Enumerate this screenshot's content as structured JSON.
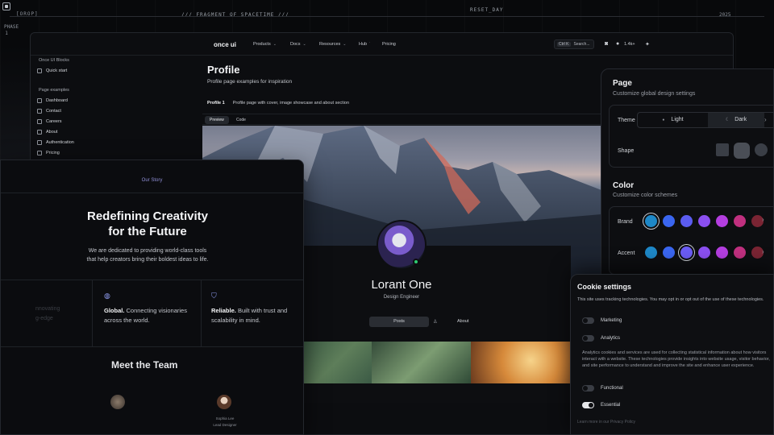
{
  "frame": {
    "bracket_tag": "[OROP]",
    "fragment": "/// FRAGMENT OF SPACETIME ///",
    "reset": "RESET_DAY",
    "year": "2025",
    "phase": "PHASE 1"
  },
  "nav": {
    "brand": "once ui",
    "items": [
      {
        "label": "Products",
        "chev": "⌄"
      },
      {
        "label": "Docs",
        "chev": "⌄"
      },
      {
        "label": "Resources",
        "chev": "⌄"
      },
      {
        "label": "Hub",
        "chev": "˙"
      },
      {
        "label": "Pricing",
        "chev": ""
      }
    ],
    "search_key": "Ctrl K",
    "search_label": "Search...",
    "stars": "1.4k+"
  },
  "sidebar": {
    "group1": "Once UI Blocks",
    "quick_start": "Quick start",
    "group2": "Page examples",
    "links": [
      "Dashboard",
      "Contact",
      "Careers",
      "About",
      "Authentication",
      "Pricing"
    ]
  },
  "page": {
    "title": "Profile",
    "subtitle": "Profile page examples for inspiration",
    "section_name": "Profile 1",
    "section_desc": "Profile page with cover, image showcase and about section",
    "tab_preview": "Preview",
    "tab_code": "Code"
  },
  "profile": {
    "name": "Lorant One",
    "role": "Design Engineer",
    "tab_posts": "Posts",
    "tab_about": "About"
  },
  "story": {
    "label": "Our Story",
    "heading_line1": "Redefining Creativity",
    "heading_line2": "for the Future",
    "para_line1": "We are dedicated to providing world-class tools",
    "para_line2": "that help creators bring their boldest ideas to life.",
    "ghost_line1": "nnovating",
    "ghost_line2": "g-edge",
    "feat1_bold": "Global.",
    "feat1_line1": " Connecting visionaries",
    "feat1_line2": "across the world.",
    "feat2_bold": "Reliable.",
    "feat2_line1": " Built with trust and",
    "feat2_line2": "scalability in mind.",
    "team_heading": "Meet the Team",
    "member2_name": "Sophia Lee",
    "member2_role": "Lead Designer"
  },
  "settings": {
    "page_heading": "Page",
    "page_sub": "Customize global design settings",
    "theme_label": "Theme",
    "theme_light": "Light",
    "theme_dark": "Dark",
    "shape_label": "Shape",
    "color_heading": "Color",
    "color_sub": "Customize color schemes",
    "brand_label": "Brand",
    "accent_label": "Accent",
    "brand_colors": [
      "#1e88c8",
      "#3a66f0",
      "#5b5cf0",
      "#8b4ff0",
      "#b43ee0",
      "#c0307f",
      "#7a2433"
    ],
    "accent_colors": [
      "#1e88c8",
      "#3a66f0",
      "#6b5cf5",
      "#8b4ff0",
      "#b43ee0",
      "#c0307f",
      "#7a2433"
    ]
  },
  "cookie": {
    "heading": "Cookie settings",
    "desc": "This site uses tracking technologies. You may opt in or opt out of the use of these technologies.",
    "marketing": "Marketing",
    "analytics": "Analytics",
    "analytics_desc": "Analytics cookies and services are used for collecting statistical information about how visitors interact with a website. These technologies provide insights into website usage, visitor behavior, and site performance to understand and improve the site and enhance user experience.",
    "functional": "Functional",
    "essential": "Essential",
    "footer": "Learn more in our Privacy Policy"
  }
}
